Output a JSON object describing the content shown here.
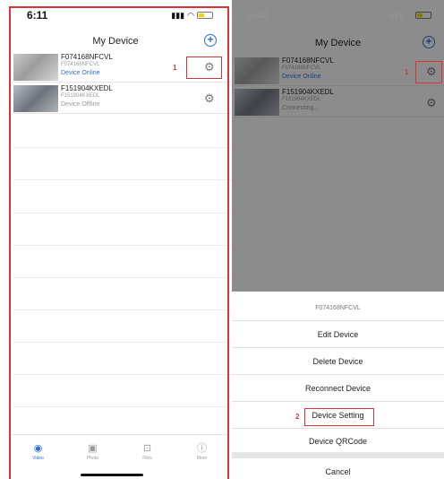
{
  "left": {
    "status_time": "6:11",
    "title": "My Device",
    "add_label": "+",
    "devices": [
      {
        "name": "F074168NFCVL",
        "id": "F074168NFCVL",
        "state": "Device Online"
      },
      {
        "name": "F151904KXEDL",
        "id": "F151904KXEDL",
        "state": "Device Offline"
      }
    ],
    "callout_number": "1",
    "tabs": [
      {
        "label": "Video",
        "icon": "video-icon"
      },
      {
        "label": "Photo",
        "icon": "photo-icon"
      },
      {
        "label": "Files",
        "icon": "files-icon"
      },
      {
        "label": "More",
        "icon": "more-icon"
      }
    ]
  },
  "right": {
    "status_time": "5:44",
    "title": "My Device",
    "add_label": "+",
    "devices": [
      {
        "name": "F074168NFCVL",
        "id": "F074168NFCVL",
        "state": "Device Online"
      },
      {
        "name": "F151904KXEDL",
        "id": "F151904KXEDL",
        "state": "Connecting..."
      }
    ],
    "callout_number_1": "1",
    "callout_number_2": "2",
    "sheet": {
      "header": "F074168NFCVL",
      "edit": "Edit Device",
      "delete": "Delete Device",
      "reconnect": "Reconnect Device",
      "setting": "Device Setting",
      "qrcode": "Device QRCode",
      "cancel": "Cancel"
    }
  },
  "colors": {
    "accent_blue": "#2f6fd6",
    "highlight_red": "#d9343d"
  },
  "icons": [
    "gear-icon",
    "plus-circle-icon",
    "wifi-icon",
    "signal-icon",
    "battery-icon"
  ]
}
